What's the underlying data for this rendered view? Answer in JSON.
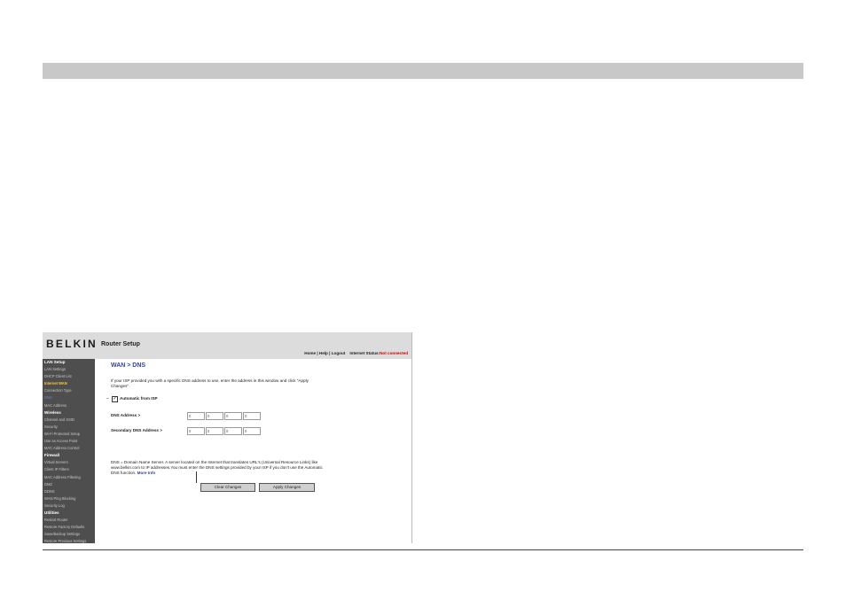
{
  "router": {
    "brand": "BELKIN",
    "app_title": "Router Setup",
    "top_links": {
      "home": "Home",
      "help": "Help",
      "logout": "Logout",
      "sep": "|",
      "status_label": "Internet Status:",
      "status_value": "Not connected"
    },
    "sidebar": {
      "items": [
        {
          "label": "LAN Setup",
          "kind": "header"
        },
        {
          "label": "LAN Settings",
          "kind": "item"
        },
        {
          "label": "DHCP Client List",
          "kind": "item"
        },
        {
          "label": "Internet WAN",
          "kind": "active"
        },
        {
          "label": "Connection Type",
          "kind": "item"
        },
        {
          "label": "DNS",
          "kind": "current"
        },
        {
          "label": "MAC Address",
          "kind": "item"
        },
        {
          "label": "Wireless",
          "kind": "header"
        },
        {
          "label": "Channel and SSID",
          "kind": "item"
        },
        {
          "label": "Security",
          "kind": "item"
        },
        {
          "label": "Wi-Fi Protected Setup",
          "kind": "item"
        },
        {
          "label": "Use as Access Point",
          "kind": "item"
        },
        {
          "label": "MAC Address Control",
          "kind": "item"
        },
        {
          "label": "Firewall",
          "kind": "header"
        },
        {
          "label": "Virtual Servers",
          "kind": "item"
        },
        {
          "label": "Client IP Filters",
          "kind": "item"
        },
        {
          "label": "MAC Address Filtering",
          "kind": "item"
        },
        {
          "label": "DMZ",
          "kind": "item"
        },
        {
          "label": "DDNS",
          "kind": "item"
        },
        {
          "label": "WAN Ping Blocking",
          "kind": "item"
        },
        {
          "label": "Security Log",
          "kind": "item"
        },
        {
          "label": "Utilities",
          "kind": "header"
        },
        {
          "label": "Restart Router",
          "kind": "item"
        },
        {
          "label": "Restore Factory Defaults",
          "kind": "item"
        },
        {
          "label": "Save/Backup Settings",
          "kind": "item"
        },
        {
          "label": "Restore Previous Settings",
          "kind": "item"
        }
      ]
    },
    "main": {
      "breadcrumb": "WAN > DNS",
      "intro": "If your ISP provided you with a specific DNS address to use, enter the address in this window and click \"Apply Changes\".",
      "auto_dash": "–",
      "auto_checked_mark": "✓",
      "auto_label": "Automatic from ISP",
      "dns_label": "DNS Address >",
      "dns_octets": [
        "0",
        "0",
        "0",
        "0"
      ],
      "secondary_label": "Secondary DNS Address >",
      "secondary_octets": [
        "0",
        "0",
        "0",
        "0"
      ],
      "description": "DNS = Domain Name Server. A server located on the Internet that translates URL's (Universal Resource Links) like www.belkin.com to IP addresses.You must enter the DNS settings provided by your ISP if you don't use the Automatic DNS function.",
      "more_info": "More Info",
      "clear_button": "Clear Changes",
      "apply_button": "Apply Changes"
    },
    "colors": {
      "sidebar_bg": "#4e4e4e",
      "accent_blue": "#33449a",
      "status_red": "#d00000",
      "active_yellow": "#ffcc33",
      "page_bar": "#c8c8c8"
    }
  }
}
